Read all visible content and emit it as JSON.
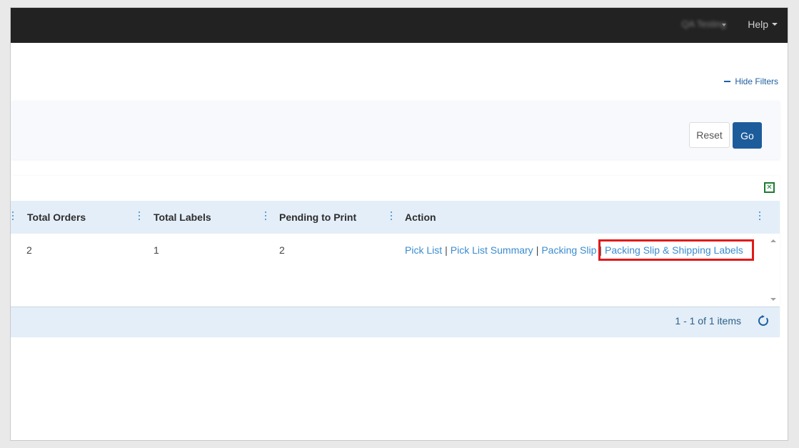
{
  "topbar": {
    "user_label": "QA Testing",
    "help_label": "Help"
  },
  "filters": {
    "hide_label": "Hide Filters",
    "reset_label": "Reset",
    "go_label": "Go"
  },
  "grid": {
    "columns": [
      "Total Orders",
      "Total Labels",
      "Pending to Print",
      "Action"
    ],
    "rows": [
      {
        "total_orders": "2",
        "total_labels": "1",
        "pending_to_print": "2",
        "actions": [
          "Pick List",
          "Pick List Summary",
          "Packing Slip",
          "Packing Slip & Shipping Labels"
        ],
        "separator": "|"
      }
    ],
    "pager_info": "1 - 1 of 1 items"
  },
  "colors": {
    "topbar": "#222222",
    "accent": "#1d5c9b",
    "header": "#e3eef8",
    "highlight": "#e11a1a"
  },
  "icons": {
    "excel_export": "excel-icon",
    "refresh": "refresh-icon"
  }
}
